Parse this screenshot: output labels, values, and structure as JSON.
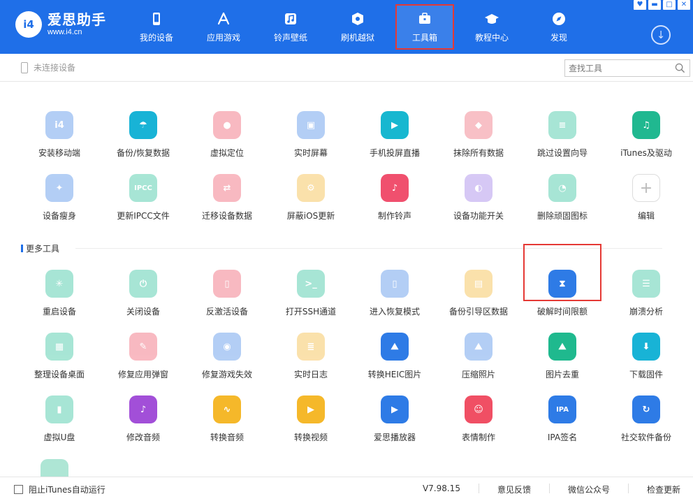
{
  "app": {
    "name": "爱思助手",
    "url": "www.i4.cn",
    "badge": "i4"
  },
  "window_controls": [
    "♥",
    "▬",
    "□",
    "✕"
  ],
  "nav": [
    {
      "label": "我的设备",
      "icon": "phone-icon"
    },
    {
      "label": "应用游戏",
      "icon": "app-store-icon"
    },
    {
      "label": "铃声壁纸",
      "icon": "music-icon"
    },
    {
      "label": "刷机越狱",
      "icon": "box-icon"
    },
    {
      "label": "工具箱",
      "icon": "briefcase-icon",
      "active": true
    },
    {
      "label": "教程中心",
      "icon": "graduation-cap-icon"
    },
    {
      "label": "发现",
      "icon": "compass-icon"
    }
  ],
  "status": {
    "device_text": "未连接设备"
  },
  "search": {
    "placeholder": "查找工具"
  },
  "tools_main": [
    {
      "label": "安装移动端",
      "icon": "i4-app-icon",
      "color": "#4d8de8",
      "faded": true,
      "glyph": "i4"
    },
    {
      "label": "备份/恢复数据",
      "icon": "umbrella-icon",
      "color": "#18b3d6",
      "faded": false,
      "glyph": "☂"
    },
    {
      "label": "虚拟定位",
      "icon": "location-pin-icon",
      "color": "#f05a6e",
      "faded": true,
      "glyph": "●"
    },
    {
      "label": "实时屏幕",
      "icon": "screen-icon",
      "color": "#4d8de8",
      "faded": true,
      "glyph": "▣"
    },
    {
      "label": "手机投屏直播",
      "icon": "phone-cast-icon",
      "color": "#17b7d0",
      "faded": false,
      "glyph": "▶"
    },
    {
      "label": "抹除所有数据",
      "icon": "eraser-icon",
      "color": "#f06a7a",
      "faded": true,
      "glyph": "◆"
    },
    {
      "label": "跳过设置向导",
      "icon": "skip-setup-icon",
      "color": "#2fc39c",
      "faded": true,
      "glyph": "≡"
    },
    {
      "label": "iTunes及驱动",
      "icon": "itunes-icon",
      "color": "#20b890",
      "faded": false,
      "glyph": "♫"
    },
    {
      "label": "设备瘦身",
      "icon": "broom-icon",
      "color": "#4d8de8",
      "faded": true,
      "glyph": "✦"
    },
    {
      "label": "更新IPCC文件",
      "icon": "ipcc-icon",
      "color": "#2fc39c",
      "faded": true,
      "glyph": "IPCC"
    },
    {
      "label": "迁移设备数据",
      "icon": "migrate-icon",
      "color": "#f05a6e",
      "faded": true,
      "glyph": "⇄"
    },
    {
      "label": "屏蔽iOS更新",
      "icon": "block-update-icon",
      "color": "#f5b83a",
      "faded": true,
      "glyph": "⚙"
    },
    {
      "label": "制作铃声",
      "icon": "ringtone-icon",
      "color": "#f0506e",
      "faded": false,
      "glyph": "♪"
    },
    {
      "label": "设备功能开关",
      "icon": "toggle-icon",
      "color": "#a07ee8",
      "faded": true,
      "glyph": "◐"
    },
    {
      "label": "删除顽固图标",
      "icon": "delete-icon-icon",
      "color": "#2fc39c",
      "faded": true,
      "glyph": "◔"
    },
    {
      "label": "编辑",
      "icon": "add-icon",
      "color": "#ffffff",
      "faded": false,
      "glyph": "+",
      "add": true
    }
  ],
  "section_more": {
    "title": "更多工具"
  },
  "tools_more": [
    {
      "label": "重启设备",
      "icon": "restart-icon",
      "color": "#2fc39c",
      "faded": true,
      "glyph": "✳"
    },
    {
      "label": "关闭设备",
      "icon": "power-icon",
      "color": "#2fc39c",
      "faded": true,
      "glyph": "⏻"
    },
    {
      "label": "反激活设备",
      "icon": "deactivate-icon",
      "color": "#f05a6e",
      "faded": true,
      "glyph": "▯"
    },
    {
      "label": "打开SSH通道",
      "icon": "terminal-icon",
      "color": "#2fc39c",
      "faded": true,
      "glyph": ">_"
    },
    {
      "label": "进入恢复模式",
      "icon": "recovery-mode-icon",
      "color": "#4d8de8",
      "faded": true,
      "glyph": "▯"
    },
    {
      "label": "备份引导区数据",
      "icon": "backup-boot-icon",
      "color": "#f5b83a",
      "faded": true,
      "glyph": "▤"
    },
    {
      "label": "破解时间限额",
      "icon": "hourglass-icon",
      "color": "#2e7be6",
      "faded": false,
      "glyph": "⧗",
      "highlighted": true
    },
    {
      "label": "崩溃分析",
      "icon": "crash-report-icon",
      "color": "#2fc39c",
      "faded": true,
      "glyph": "☰"
    },
    {
      "label": "整理设备桌面",
      "icon": "desktop-grid-icon",
      "color": "#2fc39c",
      "faded": true,
      "glyph": "▦"
    },
    {
      "label": "修复应用弹窗",
      "icon": "fix-popup-icon",
      "color": "#f05a6e",
      "faded": true,
      "glyph": "✎"
    },
    {
      "label": "修复游戏失效",
      "icon": "gamepad-icon",
      "color": "#4d8de8",
      "faded": true,
      "glyph": "◉"
    },
    {
      "label": "实时日志",
      "icon": "log-icon",
      "color": "#f5b83a",
      "faded": true,
      "glyph": "≣"
    },
    {
      "label": "转换HEIC图片",
      "icon": "heic-convert-icon",
      "color": "#2e7be6",
      "faded": false,
      "glyph": "⛰"
    },
    {
      "label": "压缩照片",
      "icon": "compress-photo-icon",
      "color": "#4d8de8",
      "faded": true,
      "glyph": "⛰"
    },
    {
      "label": "图片去重",
      "icon": "photo-dedupe-icon",
      "color": "#1fb98e",
      "faded": false,
      "glyph": "⛰"
    },
    {
      "label": "下载固件",
      "icon": "download-firmware-icon",
      "color": "#18b3d6",
      "faded": false,
      "glyph": "⬇"
    },
    {
      "label": "虚拟U盘",
      "icon": "usb-drive-icon",
      "color": "#2fc39c",
      "faded": true,
      "glyph": "▮"
    },
    {
      "label": "修改音频",
      "icon": "edit-audio-icon",
      "color": "#a24fd8",
      "faded": false,
      "glyph": "♪"
    },
    {
      "label": "转换音频",
      "icon": "convert-audio-icon",
      "color": "#f5b82a",
      "faded": false,
      "glyph": "∿"
    },
    {
      "label": "转换视频",
      "icon": "convert-video-icon",
      "color": "#f5b82a",
      "faded": false,
      "glyph": "▶"
    },
    {
      "label": "爱思播放器",
      "icon": "player-icon",
      "color": "#2e7be6",
      "faded": false,
      "glyph": "▶"
    },
    {
      "label": "表情制作",
      "icon": "emoji-icon",
      "color": "#f04f64",
      "faded": false,
      "glyph": "☺"
    },
    {
      "label": "IPA签名",
      "icon": "ipa-sign-icon",
      "color": "#2e7be6",
      "faded": false,
      "glyph": "IPA"
    },
    {
      "label": "社交软件备份",
      "icon": "social-backup-icon",
      "color": "#2e7be6",
      "faded": false,
      "glyph": "↻"
    }
  ],
  "footer": {
    "checkbox_label": "阻止iTunes自动运行",
    "version": "V7.98.15",
    "feedback": "意见反馈",
    "wechat": "微信公众号",
    "check_update": "检查更新"
  }
}
